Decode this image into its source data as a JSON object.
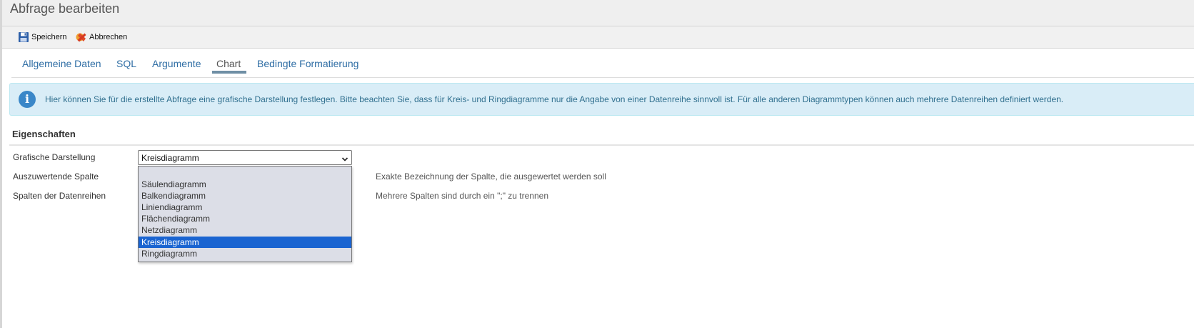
{
  "title": "Abfrage bearbeiten",
  "toolbar": {
    "save_label": "Speichern",
    "cancel_label": "Abbrechen"
  },
  "tabs": [
    {
      "label": "Allgemeine Daten"
    },
    {
      "label": "SQL"
    },
    {
      "label": "Argumente"
    },
    {
      "label": "Chart",
      "active": true
    },
    {
      "label": "Bedingte Formatierung"
    }
  ],
  "info": {
    "text": "Hier können Sie für die erstellte Abfrage eine grafische Darstellung festlegen. Bitte beachten Sie, dass für Kreis- und Ringdiagramme nur die Angabe von einer Datenreihe sinnvoll ist. Für alle anderen Diagrammtypen können auch mehrere Datenreihen definiert werden."
  },
  "section": {
    "title": "Eigenschaften"
  },
  "form": {
    "chart_type_label": "Grafische Darstellung",
    "chart_type_value": "Kreisdiagramm",
    "column_label": "Auszuwertende Spalte",
    "column_hint": "Exakte Bezeichnung der Spalte, die ausgewertet werden soll",
    "series_label": "Spalten der Datenreihen",
    "series_hint": "Mehrere Spalten sind durch ein \";\" zu trennen"
  },
  "dropdown": {
    "options": [
      {
        "label": ""
      },
      {
        "label": "Säulendiagramm"
      },
      {
        "label": "Balkendiagramm"
      },
      {
        "label": "Liniendiagramm"
      },
      {
        "label": "Flächendiagramm"
      },
      {
        "label": "Netzdiagramm"
      },
      {
        "label": "Kreisdiagramm",
        "selected": true
      },
      {
        "label": "Ringdiagramm"
      }
    ]
  },
  "colors": {
    "accent": "#2e6da4",
    "info_background": "#d9edf7",
    "info_icon": "#3a87c8",
    "selected_option": "#1a64d1"
  },
  "icons": {
    "save": "floppy-disk-icon",
    "cancel": "cancel-x-icon",
    "info": "info-circle-icon",
    "select": "chevron-down-icon"
  }
}
